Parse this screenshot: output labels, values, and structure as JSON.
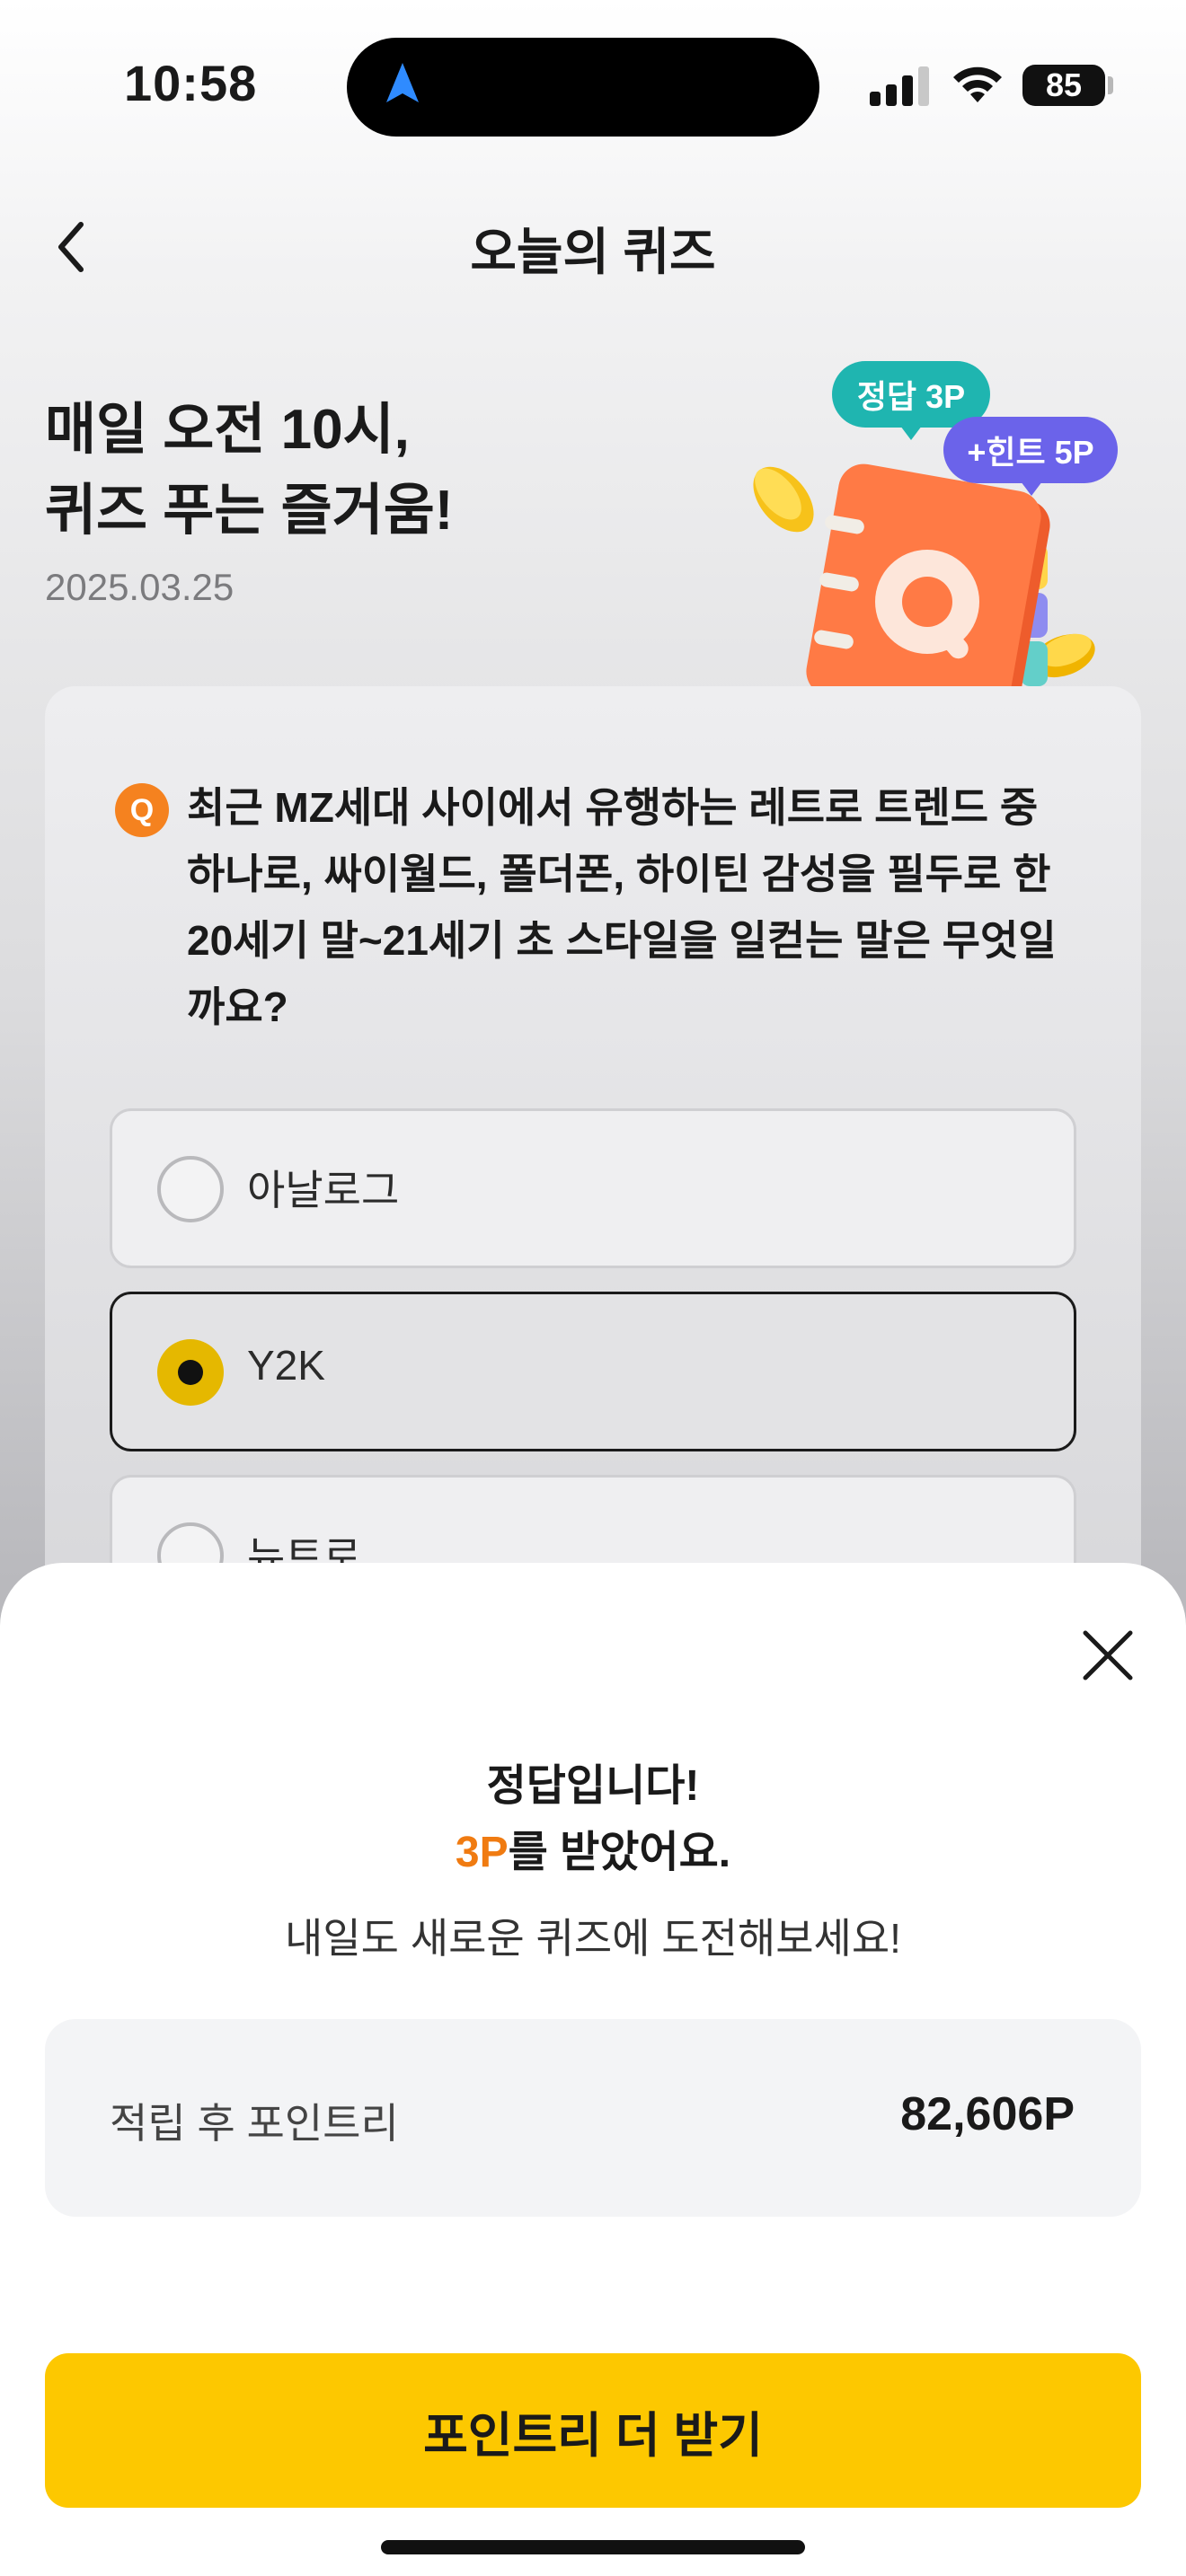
{
  "status_bar": {
    "time": "10:58",
    "battery": "85",
    "icons": [
      "navigation-arrow-icon",
      "cellular-signal-icon",
      "wifi-icon",
      "battery-icon"
    ]
  },
  "header": {
    "title": "오늘의 퀴즈",
    "back_icon": "chevron-left-icon"
  },
  "hero": {
    "title_line1": "매일 오전 10시,",
    "title_line2": "퀴즈 푸는 즐거움!",
    "date": "2025.03.25",
    "bubble_answer": "정답 3P",
    "bubble_hint": "+힌트 5P",
    "illustration": "quiz-notebook-with-coins"
  },
  "quiz": {
    "badge": "Q",
    "question": "최근 MZ세대 사이에서 유행하는 레트로 트렌드 중 하나로, 싸이월드, 폴더폰, 하이틴 감성을 필두로 한 20세기 말~21세기 초 스타일을 일컫는 말은 무엇일까요?",
    "options": [
      {
        "label": "아날로그",
        "selected": false
      },
      {
        "label": "Y2K",
        "selected": true
      },
      {
        "label": "뉴트로",
        "selected": false
      }
    ]
  },
  "result_sheet": {
    "title_line1": "정답입니다!",
    "reward": "3P",
    "reward_suffix": "를 받았어요.",
    "subtitle": "내일도 새로운 퀴즈에 도전해보세요!",
    "points_label": "적립 후 포인트리",
    "points_value": "82,606P",
    "cta_label": "포인트리 더 받기",
    "close_icon": "close-icon"
  },
  "colors": {
    "accent_orange": "#f07b11",
    "cta_yellow": "#fdc800",
    "bubble_teal": "#1fb5b0",
    "bubble_purple": "#6b63ea",
    "radio_selected": "#e5b800"
  }
}
